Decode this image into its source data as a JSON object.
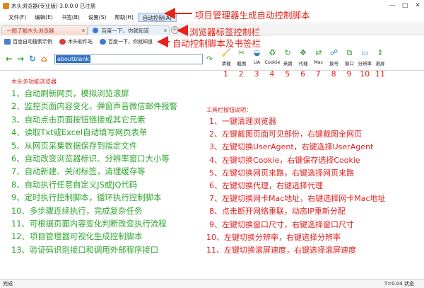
{
  "window": {
    "title": "木头浏览器(专业版) 3.0.0.0  已注册",
    "controls": [
      "—",
      "□",
      "✕"
    ]
  },
  "menu": {
    "items": [
      "文件(F)",
      "编辑(E)",
      "书签(B)",
      "设置(S)",
      "帮助(H)",
      "自动控制(A)"
    ]
  },
  "tabs": [
    {
      "label": "一图了解木头浏览器",
      "close": "x"
    },
    {
      "label": "百度一下，你就知道",
      "close": "x"
    }
  ],
  "newtab": "+",
  "bookmarks": [
    {
      "label": "百度自动搜索示例",
      "icon": "document-icon",
      "color": "#4a7fd0"
    },
    {
      "label": "木头软件站",
      "icon": "flower-icon",
      "color": "#d93b3b"
    },
    {
      "label": "百度一下，你就知道",
      "icon": "paw-icon",
      "color": "#3b78d8"
    }
  ],
  "nav": {
    "address": "aboutblank",
    "back": "←",
    "forward": "→",
    "refresh": "↻",
    "home": "⌂",
    "go": "↷"
  },
  "toolbar": [
    {
      "label": "清理",
      "glyph": "🧹",
      "color": "#7a5a2e",
      "icon": "broom-icon"
    },
    {
      "label": "截图",
      "glyph": "✂",
      "color": "#3a8e3a",
      "icon": "scissors-icon"
    },
    {
      "label": "UA",
      "glyph": "◒",
      "color": "#2d84c6",
      "icon": "ua-icon"
    },
    {
      "label": "Cookie",
      "glyph": "♻",
      "color": "#2fa52f",
      "icon": "cookie-icon"
    },
    {
      "label": "来路",
      "glyph": "↻",
      "color": "#2fa52f",
      "icon": "referrer-icon"
    },
    {
      "label": "代理",
      "glyph": "✥",
      "color": "#3a8e3a",
      "icon": "proxy-icon"
    },
    {
      "label": "Mac",
      "glyph": "⇄",
      "color": "#2fa52f",
      "icon": "mac-icon"
    },
    {
      "label": "拨号",
      "glyph": "☍",
      "color": "#2d84c6",
      "icon": "dial-icon"
    },
    {
      "label": "窗口",
      "glyph": "⧉",
      "color": "#3a8e3a",
      "icon": "window-icon"
    },
    {
      "label": "分辨率",
      "glyph": "▭",
      "color": "#2d84c6",
      "icon": "resolution-icon"
    },
    {
      "label": "滚屏",
      "glyph": "⇕",
      "color": "#2fa52f",
      "icon": "scroll-icon"
    }
  ],
  "toolbar_numbers": [
    "1",
    "2",
    "3",
    "4",
    "5",
    "6",
    "7",
    "8",
    "9",
    "10",
    "11"
  ],
  "content": {
    "left_title": "木头多功能浏览器",
    "features": [
      "1、自动刷新网页，模拟浏览滚屏",
      "2、监控页面内容变化，弹窗声音微信邮件报警",
      "3、自动点击页面按钮链接或其它元素",
      "4、读取Txt或Excel自动填写网页表单",
      "5、从网页采集数据保存到指定文件",
      "6、自动改变浏览器标识、分辨率窗口大小等",
      "7、自动新建、关闭标签，清理缓存等",
      "8、自动执行任意自定义JS或JQ代码",
      "9、定时执行控制脚本，循环执行控制脚本",
      "10、多步骤连续执行，完成复杂任务",
      "11、可根据页面内容变化判断改变执行流程",
      "12、项目管理器可视化生成控制脚本",
      "13、验证码识别接口和调用外部程序接口"
    ],
    "right_title": "工具栏按钮说明：",
    "tips": [
      "1、一键清理浏览器",
      "2、左键截图页面可见部份，右键截图全网页",
      "3、左键切换UserAgent，右键选择UserAgent",
      "4、左键切换Cookie，右键保存选择Cookie",
      "5、左键切换网页来路，右键选择网页来路",
      "6、左键切换代理，右键选择代理",
      "7、左键切换网卡Mac地址，右键选择网卡Mac地址",
      "8、点击断开网络重联，动态IP重新分配",
      "9、左键切换窗口尺寸，右键选择窗口尺寸",
      "10、左键切换分辨率，右键选择分辨率",
      "11、左键切换滚屏速度，右键选择滚屏速度"
    ]
  },
  "annotations": {
    "menu": "项目管理器生成自动控制脚本",
    "tabs": "浏览器标签控制栏",
    "bookmarks": "自动控制脚本及书签栏"
  },
  "status": {
    "left": "完成",
    "timer": "T=0.04",
    "right": "状态"
  },
  "colors": {
    "accent_red": "#e8231a",
    "feature_green": "#2fa52f",
    "address_highlight": "#3373c4"
  }
}
